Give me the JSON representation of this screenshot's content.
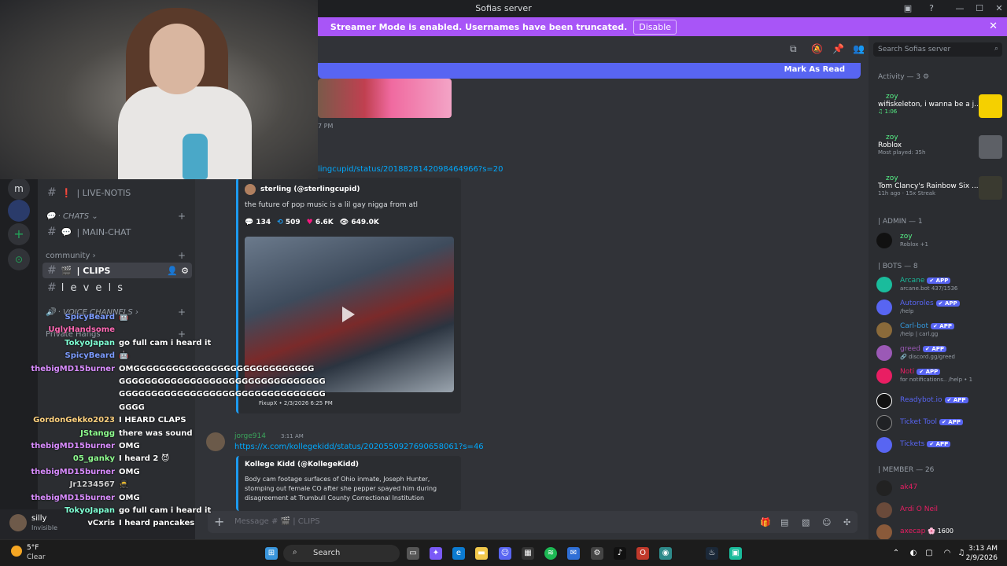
{
  "window": {
    "title": "Sofias server"
  },
  "banner": {
    "text": "Streamer Mode is enabled. Usernames have been truncated.",
    "button": "Disable"
  },
  "server_rail": {
    "top_initial": "m",
    "add": "+",
    "discover": "⊙"
  },
  "sidebar": {
    "items": [
      {
        "name": "| LIVE-NOTIS",
        "prefix": "❗"
      },
      {
        "category": "CHATS"
      },
      {
        "name": "| MAIN-CHAT",
        "prefix": "💬"
      },
      {
        "category": "community"
      },
      {
        "name": "| CLIPS",
        "prefix": "🎬",
        "active": true
      },
      {
        "name": "l e v e l s",
        "prefix": ""
      },
      {
        "category": "VOICE CHANNELS"
      },
      {
        "category": "Private Hangs"
      }
    ]
  },
  "main": {
    "mark_as_read": "Mark As Read",
    "msg1_time": "7 PM",
    "msg2_link": "lingcupid/status/2018828142098464966?s=20",
    "embed1": {
      "author": "sterling (@sterlingcupid)",
      "text": "the future of pop music is a lil gay nigga from atl",
      "replies": "134",
      "retweets": "509",
      "likes": "6.6K",
      "views": "649.0K",
      "footer": "FixupX • 2/3/2026 6:25 PM"
    },
    "msg3": {
      "author": "jorge914",
      "time": "3:11 AM",
      "link": "https://x.com/kollegekidd/status/2020550927690658061?s=46"
    },
    "embed2": {
      "author": "Kollege Kidd (@KollegeKidd)",
      "text": "Body cam footage surfaces of Ohio inmate, Joseph Hunter, stomping out female CO after she pepper spayed him during disagreement at Trumbull County Correctional Institution"
    },
    "composer_placeholder": "Message # 🎬 | CLIPS"
  },
  "members": {
    "search_placeholder": "Search Sofias server",
    "activity_header": "Activity — 3",
    "activities": [
      {
        "name": "zoy",
        "line": "wifiskeleton, i wanna be a j...",
        "sub": "♫ 1:06"
      },
      {
        "name": "zoy",
        "line": "Roblox",
        "sub": "Most played: 35h"
      },
      {
        "name": "zoy",
        "line": "Tom Clancy's Rainbow Six ...",
        "sub": "11h ago · 15x Streak"
      }
    ],
    "admin_header": "| ADMIN — 1",
    "admin": [
      {
        "name": "zoy",
        "sub": "Roblox +1",
        "color": "#57f287"
      }
    ],
    "bots_header": "| BOTS — 8",
    "bots": [
      {
        "name": "Arcane",
        "sub": "arcane.bot 437/1536",
        "color": "#1abc9c"
      },
      {
        "name": "Autoroles",
        "sub": "/help",
        "color": "#5865f2"
      },
      {
        "name": "Carl-bot",
        "sub": "/help | carl.gg",
        "color": "#3498db"
      },
      {
        "name": "greed",
        "sub": "🔗 discord.gg/greed",
        "color": "#9b59b6"
      },
      {
        "name": "Noti",
        "sub": "for notifications.. /help • 1",
        "color": "#e91e63"
      },
      {
        "name": "Readybot.io",
        "sub": "",
        "color": "#ffffff"
      },
      {
        "name": "Ticket Tool",
        "sub": "",
        "color": "#aaaaaa"
      },
      {
        "name": "Tickets",
        "sub": "",
        "color": "#5865f2"
      }
    ],
    "app_label": "✔ APP",
    "member_header": "| MEMBER — 26",
    "members": [
      {
        "name": "ak47",
        "sub": ""
      },
      {
        "name": "Ardi O Neil",
        "sub": ""
      },
      {
        "name": "axecap",
        "sub": "🌸 1600"
      }
    ]
  },
  "user_panel": {
    "name": "silly",
    "status": "Invisible"
  },
  "twitch_chat": [
    {
      "user": "SpicyBeard",
      "msg": "🤖",
      "color": "#7c9cff"
    },
    {
      "user": "UglyHandsome",
      "msg": "",
      "color": "#ff69b4"
    },
    {
      "user": "TokyoJapan",
      "msg": "go full cam i heard it",
      "color": "#7fffd4"
    },
    {
      "user": "SpicyBeard",
      "msg": "🤖",
      "color": "#7c9cff"
    },
    {
      "user": "thebigMD15burner",
      "msg": "OMGGGGGGGGGGGGGGGGGGGGGGGGGGGG",
      "color": "#d98cff"
    },
    {
      "user": "",
      "msg": "GGGGGGGGGGGGGGGGGGGGGGGGGGGGGGGG",
      "color": "#d98cff"
    },
    {
      "user": "",
      "msg": "GGGGGGGGGGGGGGGGGGGGGGGGGGGGGGGG",
      "color": "#d98cff"
    },
    {
      "user": "",
      "msg": "GGGG",
      "color": "#d98cff"
    },
    {
      "user": "GordonGekko2023",
      "msg": "I HEARD CLAPS",
      "color": "#ffd27f"
    },
    {
      "user": "JStangg",
      "msg": "there was sound",
      "color": "#8fff8f"
    },
    {
      "user": "thebigMD15burner",
      "msg": "OMG",
      "color": "#d98cff"
    },
    {
      "user": "05_ganky",
      "msg": "I heard 2 😈",
      "color": "#8fff8f"
    },
    {
      "user": "thebigMD15burner",
      "msg": "OMG",
      "color": "#d98cff"
    },
    {
      "user": "Jr1234567",
      "msg": "🥷",
      "color": "#d0d0d0"
    },
    {
      "user": "thebigMD15burner",
      "msg": "OMG",
      "color": "#d98cff"
    },
    {
      "user": "TokyoJapan",
      "msg": "go full cam i heard it",
      "color": "#7fffd4"
    },
    {
      "user": "vCxris",
      "msg": "I heard pancakes",
      "color": "#ffffff"
    }
  ],
  "taskbar": {
    "weather_temp": "5°F",
    "weather_desc": "Clear",
    "search": "Search",
    "time": "3:13 AM",
    "date": "2/9/2026"
  }
}
